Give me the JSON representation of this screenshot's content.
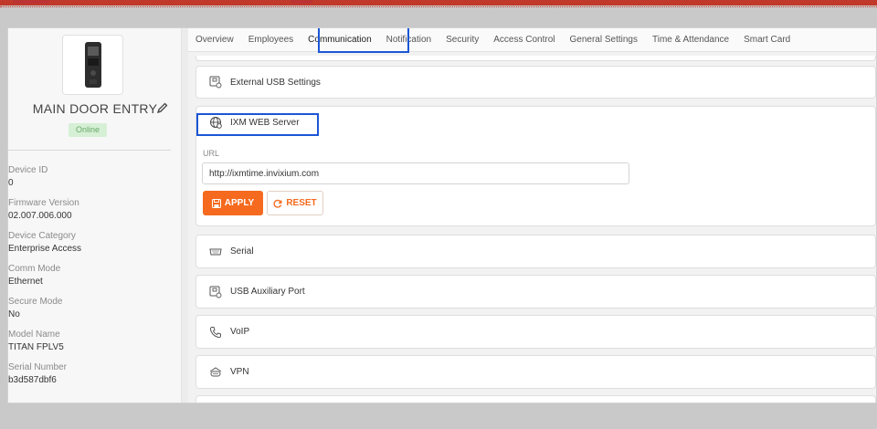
{
  "colors": {
    "accent": "#f56a1e",
    "highlight": "#1a56d6",
    "status_bg": "#d6f0d6",
    "status_text": "#6aa86a"
  },
  "device": {
    "name": "MAIN DOOR ENTRY",
    "status": "Online",
    "info": [
      {
        "label": "Device ID",
        "value": "0"
      },
      {
        "label": "Firmware Version",
        "value": "02.007.006.000"
      },
      {
        "label": "Device Category",
        "value": "Enterprise Access"
      },
      {
        "label": "Comm Mode",
        "value": "Ethernet"
      },
      {
        "label": "Secure Mode",
        "value": "No"
      },
      {
        "label": "Model Name",
        "value": "TITAN FPLV5"
      },
      {
        "label": "Serial Number",
        "value": "b3d587dbf6"
      }
    ]
  },
  "tabs": [
    "Overview",
    "Employees",
    "Communication",
    "Notification",
    "Security",
    "Access Control",
    "General Settings",
    "Time & Attendance",
    "Smart Card"
  ],
  "active_tab": "Communication",
  "sections": {
    "external_usb": {
      "label": "External USB Settings",
      "icon": "usb-settings-icon"
    },
    "ixm_web": {
      "label": "IXM WEB Server",
      "icon": "globe-icon"
    },
    "serial": {
      "label": "Serial",
      "icon": "serial-port-icon"
    },
    "usb_aux": {
      "label": "USB Auxiliary Port",
      "icon": "usb-settings-icon"
    },
    "voip": {
      "label": "VoIP",
      "icon": "phone-icon"
    },
    "vpn": {
      "label": "VPN",
      "icon": "vpn-icon"
    }
  },
  "ixm_form": {
    "url_label": "URL",
    "url_value": "http://ixmtime.invixium.com",
    "apply_label": "APPLY",
    "reset_label": "RESET"
  }
}
